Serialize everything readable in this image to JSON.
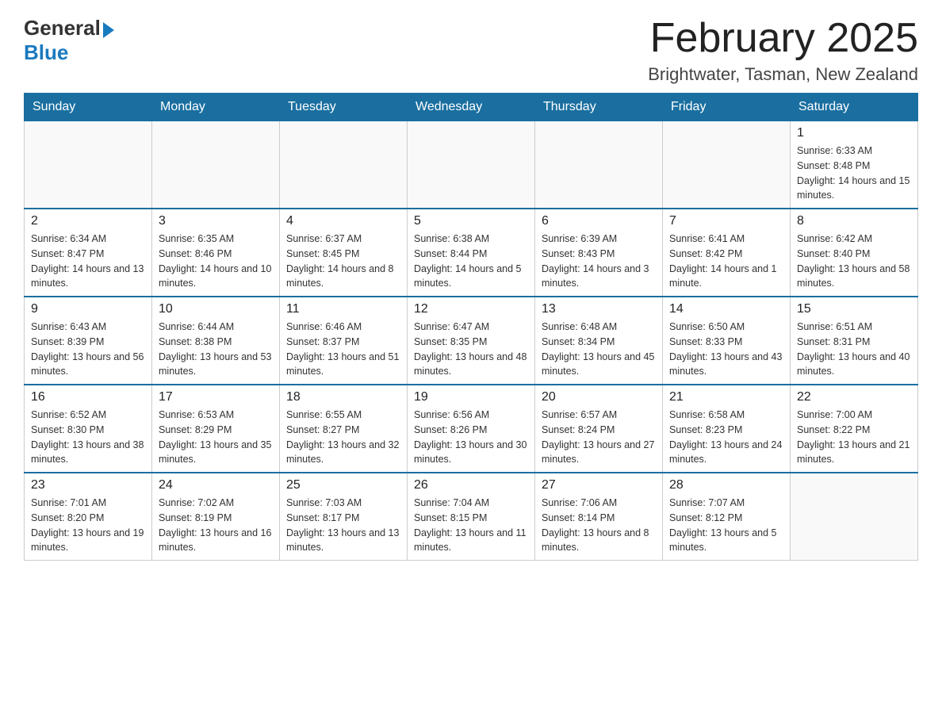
{
  "logo": {
    "general": "General",
    "blue": "Blue"
  },
  "title": "February 2025",
  "location": "Brightwater, Tasman, New Zealand",
  "days_of_week": [
    "Sunday",
    "Monday",
    "Tuesday",
    "Wednesday",
    "Thursday",
    "Friday",
    "Saturday"
  ],
  "weeks": [
    [
      {
        "day": "",
        "info": ""
      },
      {
        "day": "",
        "info": ""
      },
      {
        "day": "",
        "info": ""
      },
      {
        "day": "",
        "info": ""
      },
      {
        "day": "",
        "info": ""
      },
      {
        "day": "",
        "info": ""
      },
      {
        "day": "1",
        "info": "Sunrise: 6:33 AM\nSunset: 8:48 PM\nDaylight: 14 hours and 15 minutes."
      }
    ],
    [
      {
        "day": "2",
        "info": "Sunrise: 6:34 AM\nSunset: 8:47 PM\nDaylight: 14 hours and 13 minutes."
      },
      {
        "day": "3",
        "info": "Sunrise: 6:35 AM\nSunset: 8:46 PM\nDaylight: 14 hours and 10 minutes."
      },
      {
        "day": "4",
        "info": "Sunrise: 6:37 AM\nSunset: 8:45 PM\nDaylight: 14 hours and 8 minutes."
      },
      {
        "day": "5",
        "info": "Sunrise: 6:38 AM\nSunset: 8:44 PM\nDaylight: 14 hours and 5 minutes."
      },
      {
        "day": "6",
        "info": "Sunrise: 6:39 AM\nSunset: 8:43 PM\nDaylight: 14 hours and 3 minutes."
      },
      {
        "day": "7",
        "info": "Sunrise: 6:41 AM\nSunset: 8:42 PM\nDaylight: 14 hours and 1 minute."
      },
      {
        "day": "8",
        "info": "Sunrise: 6:42 AM\nSunset: 8:40 PM\nDaylight: 13 hours and 58 minutes."
      }
    ],
    [
      {
        "day": "9",
        "info": "Sunrise: 6:43 AM\nSunset: 8:39 PM\nDaylight: 13 hours and 56 minutes."
      },
      {
        "day": "10",
        "info": "Sunrise: 6:44 AM\nSunset: 8:38 PM\nDaylight: 13 hours and 53 minutes."
      },
      {
        "day": "11",
        "info": "Sunrise: 6:46 AM\nSunset: 8:37 PM\nDaylight: 13 hours and 51 minutes."
      },
      {
        "day": "12",
        "info": "Sunrise: 6:47 AM\nSunset: 8:35 PM\nDaylight: 13 hours and 48 minutes."
      },
      {
        "day": "13",
        "info": "Sunrise: 6:48 AM\nSunset: 8:34 PM\nDaylight: 13 hours and 45 minutes."
      },
      {
        "day": "14",
        "info": "Sunrise: 6:50 AM\nSunset: 8:33 PM\nDaylight: 13 hours and 43 minutes."
      },
      {
        "day": "15",
        "info": "Sunrise: 6:51 AM\nSunset: 8:31 PM\nDaylight: 13 hours and 40 minutes."
      }
    ],
    [
      {
        "day": "16",
        "info": "Sunrise: 6:52 AM\nSunset: 8:30 PM\nDaylight: 13 hours and 38 minutes."
      },
      {
        "day": "17",
        "info": "Sunrise: 6:53 AM\nSunset: 8:29 PM\nDaylight: 13 hours and 35 minutes."
      },
      {
        "day": "18",
        "info": "Sunrise: 6:55 AM\nSunset: 8:27 PM\nDaylight: 13 hours and 32 minutes."
      },
      {
        "day": "19",
        "info": "Sunrise: 6:56 AM\nSunset: 8:26 PM\nDaylight: 13 hours and 30 minutes."
      },
      {
        "day": "20",
        "info": "Sunrise: 6:57 AM\nSunset: 8:24 PM\nDaylight: 13 hours and 27 minutes."
      },
      {
        "day": "21",
        "info": "Sunrise: 6:58 AM\nSunset: 8:23 PM\nDaylight: 13 hours and 24 minutes."
      },
      {
        "day": "22",
        "info": "Sunrise: 7:00 AM\nSunset: 8:22 PM\nDaylight: 13 hours and 21 minutes."
      }
    ],
    [
      {
        "day": "23",
        "info": "Sunrise: 7:01 AM\nSunset: 8:20 PM\nDaylight: 13 hours and 19 minutes."
      },
      {
        "day": "24",
        "info": "Sunrise: 7:02 AM\nSunset: 8:19 PM\nDaylight: 13 hours and 16 minutes."
      },
      {
        "day": "25",
        "info": "Sunrise: 7:03 AM\nSunset: 8:17 PM\nDaylight: 13 hours and 13 minutes."
      },
      {
        "day": "26",
        "info": "Sunrise: 7:04 AM\nSunset: 8:15 PM\nDaylight: 13 hours and 11 minutes."
      },
      {
        "day": "27",
        "info": "Sunrise: 7:06 AM\nSunset: 8:14 PM\nDaylight: 13 hours and 8 minutes."
      },
      {
        "day": "28",
        "info": "Sunrise: 7:07 AM\nSunset: 8:12 PM\nDaylight: 13 hours and 5 minutes."
      },
      {
        "day": "",
        "info": ""
      }
    ]
  ]
}
